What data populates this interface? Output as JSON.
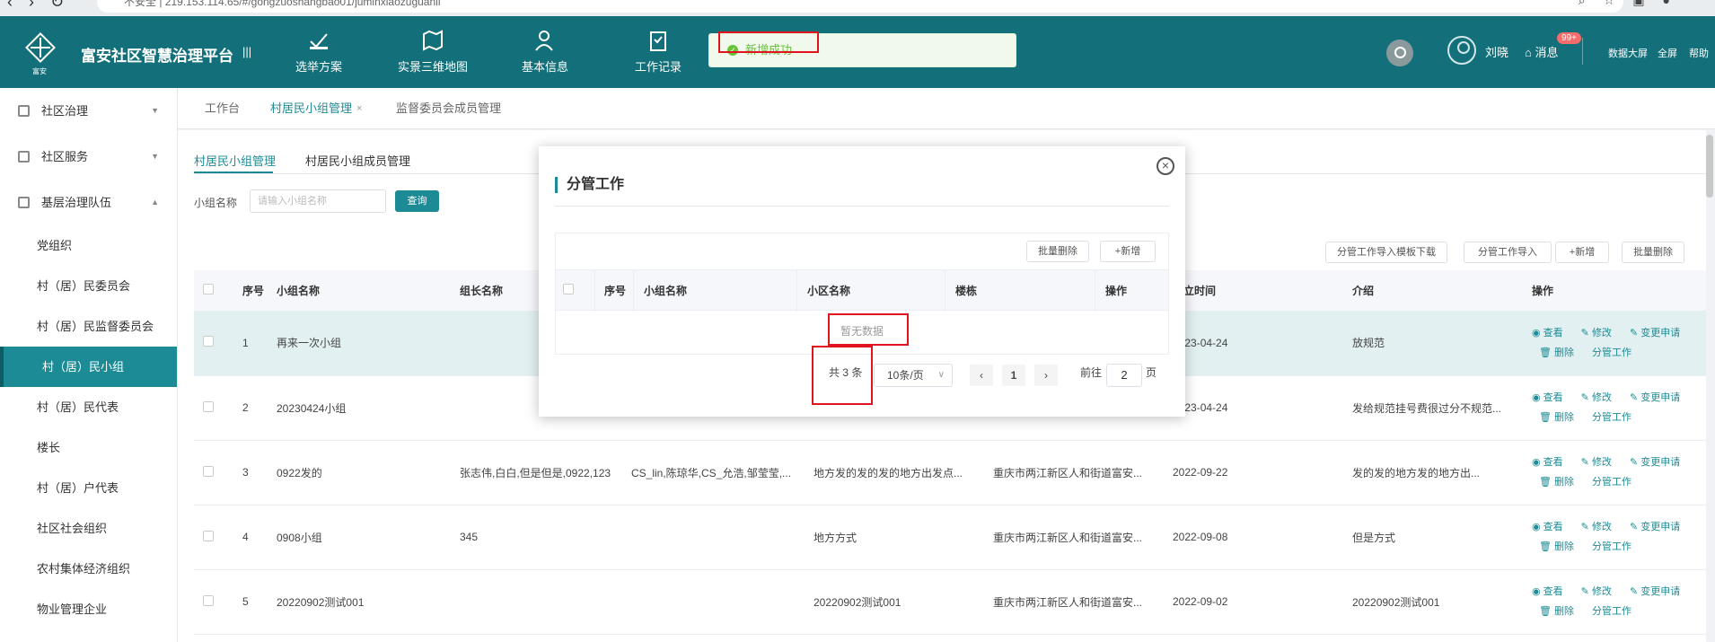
{
  "browser": {
    "url": "不安全 | 219.153.114.65/#/gongzuoshangbao01/juminxiaozuguanli"
  },
  "header": {
    "title": "富安社区智慧治理平台",
    "nav": [
      {
        "label": "选举方案",
        "icon": "ballot-icon"
      },
      {
        "label": "实景三维地图",
        "icon": "map-icon"
      },
      {
        "label": "基本信息",
        "icon": "user-info-icon"
      },
      {
        "label": "工作记录",
        "icon": "clipboard-icon"
      }
    ],
    "toast": "新增成功",
    "user": "刘晓",
    "messages_label": "消息",
    "messages_badge": "99+",
    "links": [
      "数据大屏",
      "全屏",
      "帮助"
    ]
  },
  "sidebar": {
    "groups": [
      {
        "label": "社区治理"
      },
      {
        "label": "社区服务"
      },
      {
        "label": "基层治理队伍"
      }
    ],
    "items": [
      "党组织",
      "村（居）民委员会",
      "村（居）民监督委员会",
      "村（居）民小组",
      "村（居）民代表",
      "楼长",
      "村（居）户代表",
      "社区社会组织",
      "农村集体经济组织",
      "物业管理企业"
    ],
    "active_item": "村（居）民小组"
  },
  "tabs": {
    "workbench": "工作台",
    "current": "村居民小组管理",
    "close": "×",
    "supervision": "监督委员会成员管理"
  },
  "content": {
    "subtab_groups": "村居民小组管理",
    "subtab_members": "村居民小组成员管理",
    "filter_label": "小组名称",
    "filter_placeholder": "请输入小组名称",
    "query": "查询",
    "toolbar": {
      "import_template": "分管工作导入模板下载",
      "import": "分管工作导入",
      "add": "+新增",
      "batch_delete": "批量删除"
    },
    "table": {
      "headers": [
        "序号",
        "小组名称",
        "组长名称",
        "",
        "",
        "",
        "成立时间",
        "介绍",
        "操作"
      ],
      "rows": [
        {
          "no": "1",
          "name": "再来一次小组",
          "leader": "",
          "c4": "",
          "c5": "",
          "c6": "",
          "date": "2023-04-24",
          "intro": "放规范"
        },
        {
          "no": "2",
          "name": "20230424小组",
          "leader": "",
          "c4": "",
          "c5": "",
          "c6": "",
          "date": "2023-04-24",
          "intro": "发给规范挂号费很过分不规范..."
        },
        {
          "no": "3",
          "name": "0922发的",
          "leader": "张志伟,白白,但是但是,0922,123",
          "c4": "CS_lin,陈琼华,CS_允浩,邹莹莹,...",
          "c5": "地方发的发的发的地方出发点...",
          "c6": "重庆市两江新区人和街道富安...",
          "date": "2022-09-22",
          "intro": "发的发的地方发的地方出..."
        },
        {
          "no": "4",
          "name": "0908小组",
          "leader": "345",
          "c4": "",
          "c5": "地方方式",
          "c6": "重庆市两江新区人和街道富安...",
          "date": "2022-09-08",
          "intro": "但是方式"
        },
        {
          "no": "5",
          "name": "20220902测试001",
          "leader": "",
          "c4": "",
          "c5": "20220902测试001",
          "c6": "重庆市两江新区人和街道富安...",
          "date": "2022-09-02",
          "intro": "20220902测试001"
        }
      ],
      "ops": {
        "view": "查看",
        "edit": "修改",
        "change": "变更申请",
        "delete": "删除",
        "assign": "分管工作"
      }
    }
  },
  "modal": {
    "title": "分管工作",
    "batch_delete": "批量删除",
    "add": "+新增",
    "headers": [
      "序号",
      "小组名称",
      "小区名称",
      "楼栋",
      "操作"
    ],
    "empty": "暂无数据",
    "total": "共 3 条",
    "page_size": "10条/页",
    "prev": "‹",
    "page": "1",
    "next": "›",
    "goto_label": "前往",
    "goto_value": "2",
    "page_unit": "页"
  }
}
